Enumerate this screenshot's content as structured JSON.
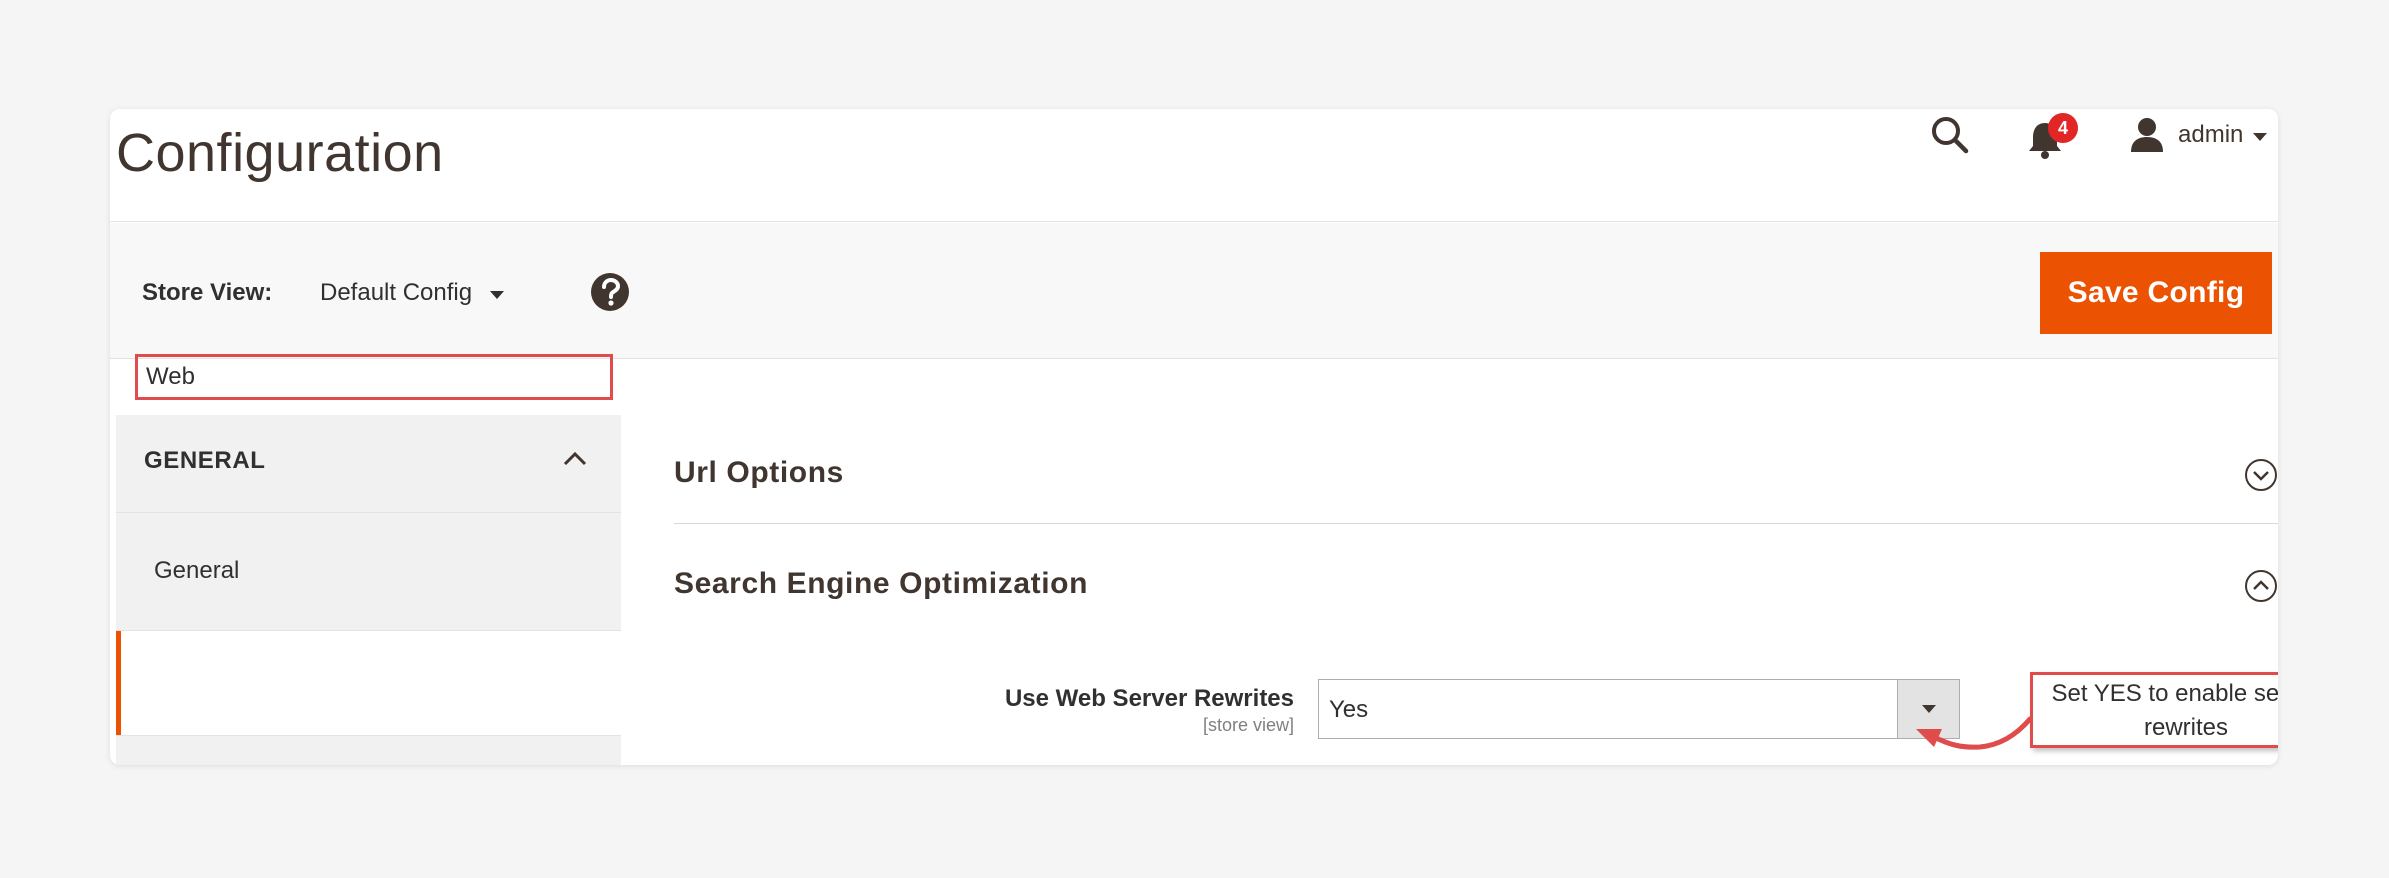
{
  "header": {
    "title": "Configuration",
    "notifications_count": "4",
    "user_name": "admin"
  },
  "toolbar": {
    "store_view_label": "Store View:",
    "store_view_value": "Default Config",
    "save_label": "Save Config"
  },
  "sidebar": {
    "group_title": "GENERAL",
    "items": [
      {
        "label": "General"
      },
      {
        "label": "Web"
      }
    ]
  },
  "sections": [
    {
      "title": "Url Options",
      "state": "collapsed"
    },
    {
      "title": "Search Engine Optimization",
      "state": "expanded"
    }
  ],
  "field": {
    "label": "Use Web Server Rewrites",
    "scope": "[store view]",
    "value": "Yes"
  },
  "annotation": {
    "text_line1": "Set YES to enable server",
    "text_line2": "rewrites"
  },
  "colors": {
    "accent": "#eb5202",
    "highlight": "#e04b4b",
    "badge": "#e22626"
  }
}
